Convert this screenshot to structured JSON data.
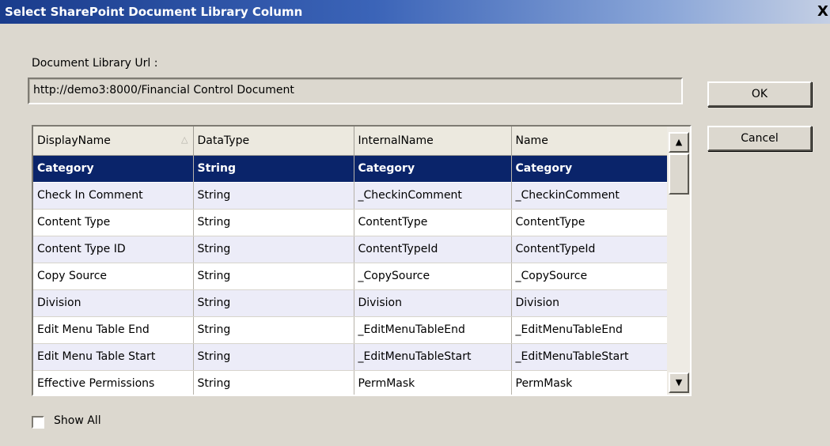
{
  "window": {
    "title": "Select SharePoint Document Library Column",
    "close_glyph": "X"
  },
  "url": {
    "label": "Document Library Url :",
    "value": "http://demo3:8000/Financial Control Document"
  },
  "buttons": {
    "ok": "OK",
    "cancel": "Cancel"
  },
  "grid": {
    "columns": [
      "DisplayName",
      "DataType",
      "InternalName",
      "Name"
    ],
    "sort_column": "DisplayName",
    "sort_direction": "ascending",
    "selected_row": 0,
    "rows": [
      [
        "Category",
        "String",
        "Category",
        "Category"
      ],
      [
        "Check In Comment",
        "String",
        "_CheckinComment",
        "_CheckinComment"
      ],
      [
        "Content Type",
        "String",
        "ContentType",
        "ContentType"
      ],
      [
        "Content Type ID",
        "String",
        "ContentTypeId",
        "ContentTypeId"
      ],
      [
        "Copy Source",
        "String",
        "_CopySource",
        "_CopySource"
      ],
      [
        "Division",
        "String",
        "Division",
        "Division"
      ],
      [
        "Edit Menu Table End",
        "String",
        "_EditMenuTableEnd",
        "_EditMenuTableEnd"
      ],
      [
        "Edit Menu Table Start",
        "String",
        "_EditMenuTableStart",
        "_EditMenuTableStart"
      ],
      [
        "Effective Permissions",
        "String",
        "PermMask",
        "PermMask"
      ]
    ]
  },
  "show_all": {
    "label": "Show All",
    "checked": false
  },
  "colors": {
    "selection": "#0a246a",
    "row_alternate": "#ececf8",
    "dialog_background": "#dcd8cf"
  }
}
